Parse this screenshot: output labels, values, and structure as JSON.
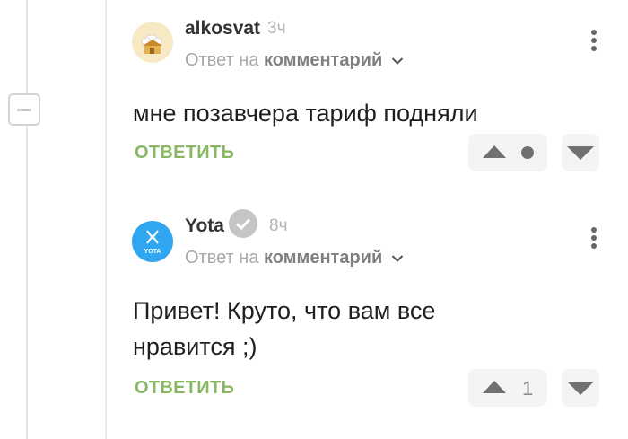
{
  "comments": [
    {
      "author": "alkosvat",
      "time": "3ч",
      "reply_prefix": "Ответ на",
      "reply_link": "комментарий",
      "text_lines": [
        "мне позавчера тариф подняли"
      ],
      "reply_button": "ОТВЕТИТЬ",
      "rating": ""
    },
    {
      "author": "Yota",
      "time": "8ч",
      "avatar_text": "YOTA",
      "reply_prefix": "Ответ на",
      "reply_link": "комментарий",
      "text_lines": [
        "Привет! Круто, что вам все",
        "нравится ;)"
      ],
      "reply_button": "ОТВЕТИТЬ",
      "rating": "1"
    }
  ],
  "colors": {
    "reply_green": "#8ab862",
    "yota_blue": "#31a6f0",
    "thread_line": "#e5e5e5"
  },
  "icons": [
    "collapse-minus-icon",
    "chevron-down-icon",
    "kebab-menu-icon",
    "verified-check-icon",
    "vote-up-icon",
    "vote-down-icon"
  ]
}
